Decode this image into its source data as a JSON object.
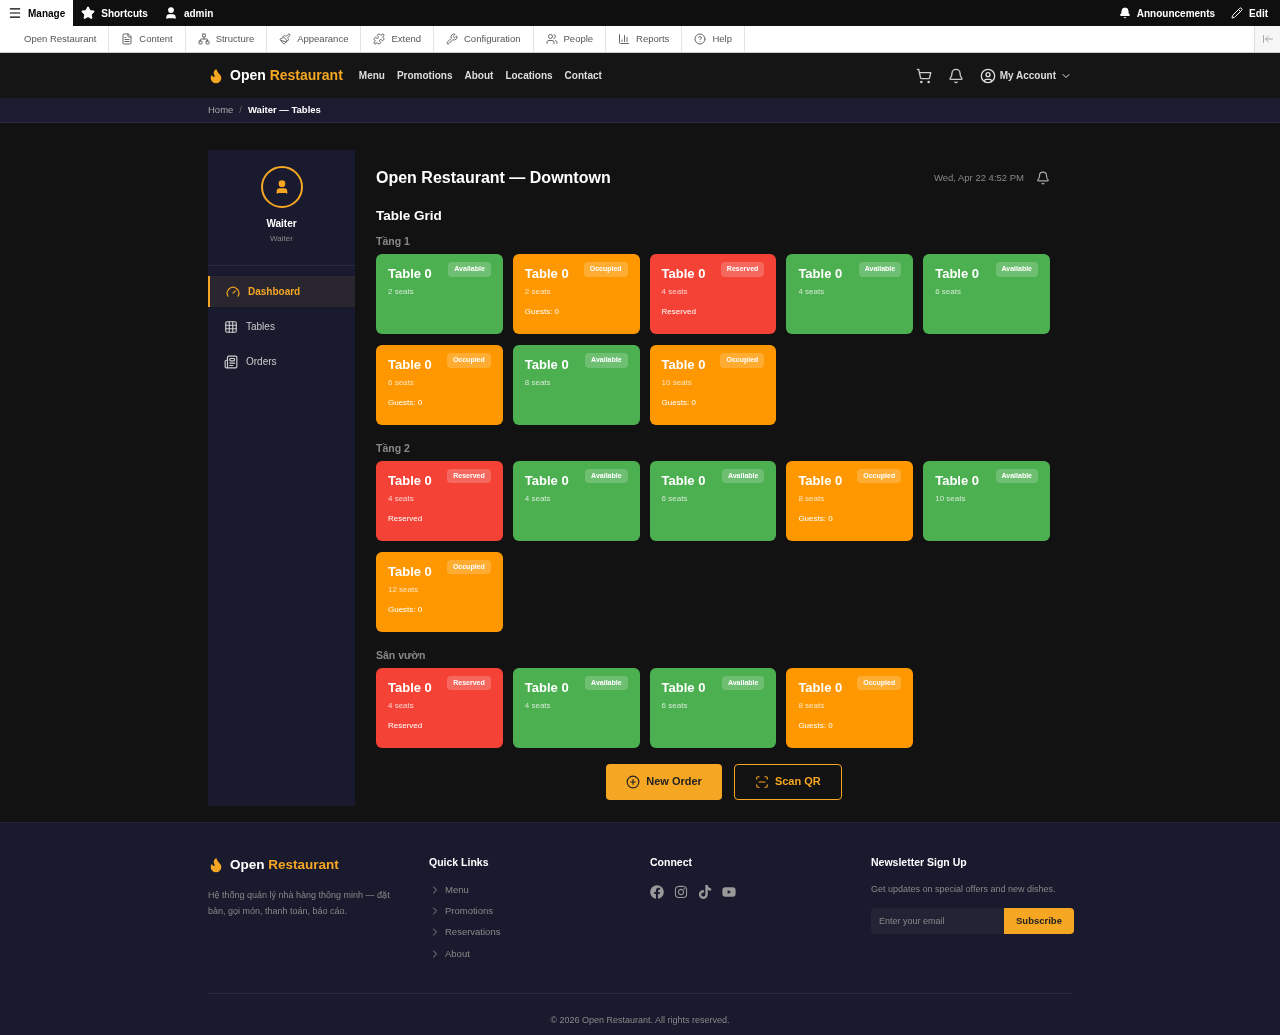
{
  "admin_toolbar": {
    "items": [
      {
        "label": "Manage",
        "selected": true
      },
      {
        "label": "Shortcuts",
        "selected": false
      },
      {
        "label": "admin",
        "selected": false
      }
    ],
    "right": [
      "Announcements",
      "Edit"
    ]
  },
  "admin_menu": [
    "Open Restaurant",
    "Content",
    "Structure",
    "Appearance",
    "Extend",
    "Configuration",
    "People",
    "Reports",
    "Help"
  ],
  "site_header": {
    "brand": [
      "Open",
      "Restaurant"
    ],
    "nav": [
      "Menu",
      "Promotions",
      "About",
      "Locations",
      "Contact"
    ],
    "account": "My Account"
  },
  "breadcrumb": {
    "items": [
      "Home",
      "Waiter — Tables"
    ],
    "separator": "/"
  },
  "sidebar": {
    "user": {
      "name": "Waiter",
      "role": "Waiter"
    },
    "items": [
      {
        "label": "Dashboard",
        "selected": true
      },
      {
        "label": "Tables",
        "selected": false
      },
      {
        "label": "Orders",
        "selected": false
      }
    ]
  },
  "page": {
    "title": "Open Restaurant — Downtown",
    "datetime": "Wed, Apr 22 4:52 PM",
    "section_title": "Table Grid",
    "floors": [
      {
        "name": "Tầng 1",
        "tables": [
          {
            "name": "Table 0",
            "kind": "available",
            "badge": "Available",
            "seats": "2 seats"
          },
          {
            "name": "Table 0",
            "kind": "occupied",
            "badge": "Occupied",
            "seats": "2 seats",
            "note": "Guests: 0"
          },
          {
            "name": "Table 0",
            "kind": "reserved",
            "badge": "Reserved",
            "seats": "4 seats",
            "note": "Reserved"
          },
          {
            "name": "Table 0",
            "kind": "available",
            "badge": "Available",
            "seats": "4 seats"
          },
          {
            "name": "Table 0",
            "kind": "available",
            "badge": "Available",
            "seats": "6 seats"
          },
          {
            "name": "Table 0",
            "kind": "occupied",
            "badge": "Occupied",
            "seats": "6 seats",
            "note": "Guests: 0"
          },
          {
            "name": "Table 0",
            "kind": "available",
            "badge": "Available",
            "seats": "8 seats"
          },
          {
            "name": "Table 0",
            "kind": "occupied",
            "badge": "Occupied",
            "seats": "10 seats",
            "note": "Guests: 0"
          }
        ]
      },
      {
        "name": "Tầng 2",
        "tables": [
          {
            "name": "Table 0",
            "kind": "reserved",
            "badge": "Reserved",
            "seats": "4 seats",
            "note": "Reserved"
          },
          {
            "name": "Table 0",
            "kind": "available",
            "badge": "Available",
            "seats": "4 seats"
          },
          {
            "name": "Table 0",
            "kind": "available",
            "badge": "Available",
            "seats": "6 seats"
          },
          {
            "name": "Table 0",
            "kind": "occupied",
            "badge": "Occupied",
            "seats": "8 seats",
            "note": "Guests: 0"
          },
          {
            "name": "Table 0",
            "kind": "available",
            "badge": "Available",
            "seats": "10 seats"
          },
          {
            "name": "Table 0",
            "kind": "occupied",
            "badge": "Occupied",
            "seats": "12 seats",
            "note": "Guests: 0"
          }
        ]
      },
      {
        "name": "Sân vườn",
        "tables": [
          {
            "name": "Table 0",
            "kind": "reserved",
            "badge": "Reserved",
            "seats": "4 seats",
            "note": "Reserved"
          },
          {
            "name": "Table 0",
            "kind": "available",
            "badge": "Available",
            "seats": "4 seats"
          },
          {
            "name": "Table 0",
            "kind": "available",
            "badge": "Available",
            "seats": "6 seats"
          },
          {
            "name": "Table 0",
            "kind": "occupied",
            "badge": "Occupied",
            "seats": "8 seats",
            "note": "Guests: 0"
          }
        ]
      }
    ],
    "actions": [
      {
        "label": "New Order",
        "kind": "primary"
      },
      {
        "label": "Scan QR",
        "kind": "outline"
      }
    ]
  },
  "footer": {
    "brand": [
      "Open",
      "Restaurant"
    ],
    "description": "Hệ thống quản lý nhà hàng thông minh — đặt bàn, gọi món, thanh toán, báo cáo.",
    "quick_links_title": "Quick Links",
    "quick_links": [
      "Menu",
      "Promotions",
      "Reservations",
      "About"
    ],
    "connect_title": "Connect",
    "newsletter_title": "Newsletter Sign Up",
    "newsletter_text": "Get updates on special offers and new dishes.",
    "email_placeholder": "Enter your email",
    "subscribe": "Subscribe",
    "copyright": "© 2026 Open Restaurant. All rights reserved."
  }
}
